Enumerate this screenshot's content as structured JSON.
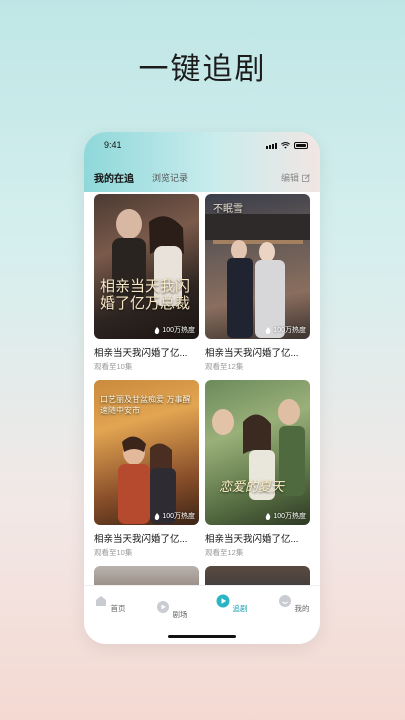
{
  "headline": "一键追剧",
  "status_bar": {
    "time": "9:41"
  },
  "tabs": {
    "active": "我的在追",
    "history": "浏览记录",
    "edit": "编辑"
  },
  "cards": [
    {
      "title": "相亲当天我闪婚了亿...",
      "progress": "观看至10集",
      "heat": "100万热度",
      "poster_text": "相亲当天我闪婚了亿万总裁"
    },
    {
      "title": "相亲当天我闪婚了亿...",
      "progress": "观看至12集",
      "heat": "100万热度",
      "poster_text": "不眠雪"
    },
    {
      "title": "相亲当天我闪婚了亿...",
      "progress": "观看至10集",
      "heat": "100万热度",
      "poster_text": "口艺丽及甘盆痴爱 万事醒速随中安市"
    },
    {
      "title": "相亲当天我闪婚了亿...",
      "progress": "观看至12集",
      "heat": "100万热度",
      "poster_text": "恋爱的夏天"
    }
  ],
  "nav": [
    {
      "label": "首页",
      "icon": "home-icon"
    },
    {
      "label": "剧场",
      "icon": "theater-icon"
    },
    {
      "label": "追剧",
      "icon": "play-icon"
    },
    {
      "label": "我的",
      "icon": "profile-icon"
    }
  ],
  "colors": {
    "accent": "#1aa3b3"
  }
}
